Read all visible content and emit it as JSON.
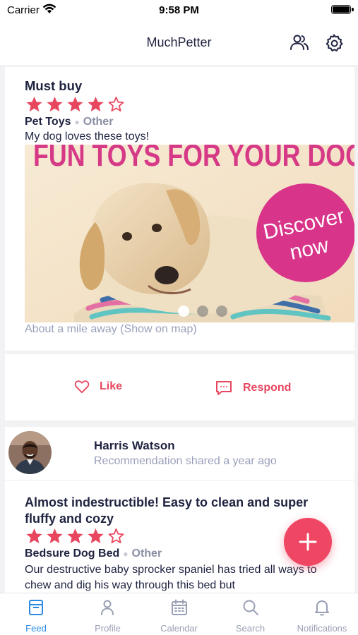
{
  "status_bar": {
    "carrier": "Carrier",
    "time": "9:58 PM"
  },
  "nav": {
    "title": "MuchPetter",
    "friends_icon": "friends-icon",
    "settings_icon": "gear-icon"
  },
  "post1": {
    "title": "Must buy",
    "rating": 4,
    "rating_max": 5,
    "category": "Pet Toys",
    "subcategory": "Other",
    "description": "My dog loves these toys!",
    "image": {
      "headline": "FUN TOYS FOR YOUR DOG",
      "badge_line1": "Discover",
      "badge_line2": "now",
      "carousel_count": 3,
      "carousel_active": 0
    },
    "location_text": "About a mile away",
    "location_link": "(Show on map)",
    "actions": {
      "like_label": "Like",
      "respond_label": "Respond"
    }
  },
  "post2": {
    "author_name": "Harris Watson",
    "author_subtitle": "Recommendation shared a year ago",
    "title": "Almost indestructible! Easy to clean and super fluffy and cozy",
    "rating": 4,
    "rating_max": 5,
    "category": "Bedsure Dog Bed",
    "subcategory": "Other",
    "description": "Our destructive baby sprocker spaniel has tried all ways to chew and dig his way through this bed but"
  },
  "tabs": [
    {
      "label": "Feed",
      "icon": "feed-icon",
      "active": true
    },
    {
      "label": "Profile",
      "icon": "profile-icon",
      "active": false
    },
    {
      "label": "Calendar",
      "icon": "calendar-icon",
      "active": false
    },
    {
      "label": "Search",
      "icon": "search-icon",
      "active": false
    },
    {
      "label": "Notifications",
      "icon": "bell-icon",
      "active": false
    }
  ],
  "colors": {
    "accent": "#ef4763",
    "star": "#e8465f",
    "tab_active": "#2a8ae6",
    "muted": "#9aa0bb",
    "text": "#1f2340"
  }
}
